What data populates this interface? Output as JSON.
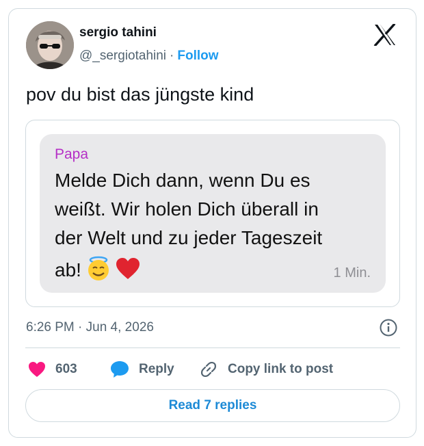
{
  "author": {
    "name": "sergio tahini",
    "handle": "@_sergiotahini",
    "separator": "·",
    "follow_label": "Follow"
  },
  "brand": {
    "logo_icon": "x-logo-icon",
    "color": "#0f1419"
  },
  "tweet": {
    "text": "pov du bist das jüngste kind"
  },
  "embedded_message": {
    "sender": "Papa",
    "lines": [
      "Melde Dich dann, wenn Du es",
      "weißt. Wir holen Dich überall in",
      "der Welt und zu jeder Tageszeit",
      "ab!"
    ],
    "emojis": [
      "😇",
      "❤️"
    ],
    "time": "1 Min.",
    "bubble_color": "#e9e9eb",
    "sender_color": "#b52fc6"
  },
  "meta": {
    "timestamp": "6:26 PM · Jun 4, 2026",
    "info_icon": "info-icon"
  },
  "actions": {
    "likes_count": "603",
    "reply_label": "Reply",
    "copy_label": "Copy link to post",
    "like_color": "#f91880",
    "reply_color": "#1d9bf0"
  },
  "read_replies_label": "Read 7 replies",
  "colors": {
    "accent": "#1d9bf0",
    "secondary_text": "#536471",
    "border": "#cfd9de"
  }
}
